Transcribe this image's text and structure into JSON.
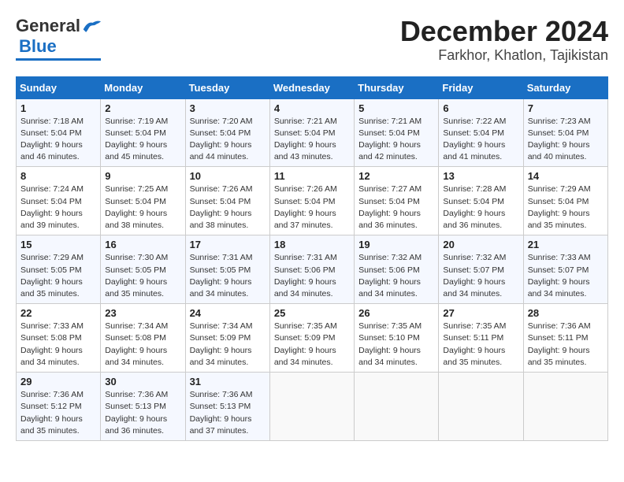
{
  "header": {
    "logo_general": "General",
    "logo_blue": "Blue",
    "month_title": "December 2024",
    "location": "Farkhor, Khatlon, Tajikistan"
  },
  "weekdays": [
    "Sunday",
    "Monday",
    "Tuesday",
    "Wednesday",
    "Thursday",
    "Friday",
    "Saturday"
  ],
  "weeks": [
    [
      {
        "day": "1",
        "sunrise": "7:18 AM",
        "sunset": "5:04 PM",
        "daylight": "9 hours and 46 minutes."
      },
      {
        "day": "2",
        "sunrise": "7:19 AM",
        "sunset": "5:04 PM",
        "daylight": "9 hours and 45 minutes."
      },
      {
        "day": "3",
        "sunrise": "7:20 AM",
        "sunset": "5:04 PM",
        "daylight": "9 hours and 44 minutes."
      },
      {
        "day": "4",
        "sunrise": "7:21 AM",
        "sunset": "5:04 PM",
        "daylight": "9 hours and 43 minutes."
      },
      {
        "day": "5",
        "sunrise": "7:21 AM",
        "sunset": "5:04 PM",
        "daylight": "9 hours and 42 minutes."
      },
      {
        "day": "6",
        "sunrise": "7:22 AM",
        "sunset": "5:04 PM",
        "daylight": "9 hours and 41 minutes."
      },
      {
        "day": "7",
        "sunrise": "7:23 AM",
        "sunset": "5:04 PM",
        "daylight": "9 hours and 40 minutes."
      }
    ],
    [
      {
        "day": "8",
        "sunrise": "7:24 AM",
        "sunset": "5:04 PM",
        "daylight": "9 hours and 39 minutes."
      },
      {
        "day": "9",
        "sunrise": "7:25 AM",
        "sunset": "5:04 PM",
        "daylight": "9 hours and 38 minutes."
      },
      {
        "day": "10",
        "sunrise": "7:26 AM",
        "sunset": "5:04 PM",
        "daylight": "9 hours and 38 minutes."
      },
      {
        "day": "11",
        "sunrise": "7:26 AM",
        "sunset": "5:04 PM",
        "daylight": "9 hours and 37 minutes."
      },
      {
        "day": "12",
        "sunrise": "7:27 AM",
        "sunset": "5:04 PM",
        "daylight": "9 hours and 36 minutes."
      },
      {
        "day": "13",
        "sunrise": "7:28 AM",
        "sunset": "5:04 PM",
        "daylight": "9 hours and 36 minutes."
      },
      {
        "day": "14",
        "sunrise": "7:29 AM",
        "sunset": "5:04 PM",
        "daylight": "9 hours and 35 minutes."
      }
    ],
    [
      {
        "day": "15",
        "sunrise": "7:29 AM",
        "sunset": "5:05 PM",
        "daylight": "9 hours and 35 minutes."
      },
      {
        "day": "16",
        "sunrise": "7:30 AM",
        "sunset": "5:05 PM",
        "daylight": "9 hours and 35 minutes."
      },
      {
        "day": "17",
        "sunrise": "7:31 AM",
        "sunset": "5:05 PM",
        "daylight": "9 hours and 34 minutes."
      },
      {
        "day": "18",
        "sunrise": "7:31 AM",
        "sunset": "5:06 PM",
        "daylight": "9 hours and 34 minutes."
      },
      {
        "day": "19",
        "sunrise": "7:32 AM",
        "sunset": "5:06 PM",
        "daylight": "9 hours and 34 minutes."
      },
      {
        "day": "20",
        "sunrise": "7:32 AM",
        "sunset": "5:07 PM",
        "daylight": "9 hours and 34 minutes."
      },
      {
        "day": "21",
        "sunrise": "7:33 AM",
        "sunset": "5:07 PM",
        "daylight": "9 hours and 34 minutes."
      }
    ],
    [
      {
        "day": "22",
        "sunrise": "7:33 AM",
        "sunset": "5:08 PM",
        "daylight": "9 hours and 34 minutes."
      },
      {
        "day": "23",
        "sunrise": "7:34 AM",
        "sunset": "5:08 PM",
        "daylight": "9 hours and 34 minutes."
      },
      {
        "day": "24",
        "sunrise": "7:34 AM",
        "sunset": "5:09 PM",
        "daylight": "9 hours and 34 minutes."
      },
      {
        "day": "25",
        "sunrise": "7:35 AM",
        "sunset": "5:09 PM",
        "daylight": "9 hours and 34 minutes."
      },
      {
        "day": "26",
        "sunrise": "7:35 AM",
        "sunset": "5:10 PM",
        "daylight": "9 hours and 34 minutes."
      },
      {
        "day": "27",
        "sunrise": "7:35 AM",
        "sunset": "5:11 PM",
        "daylight": "9 hours and 35 minutes."
      },
      {
        "day": "28",
        "sunrise": "7:36 AM",
        "sunset": "5:11 PM",
        "daylight": "9 hours and 35 minutes."
      }
    ],
    [
      {
        "day": "29",
        "sunrise": "7:36 AM",
        "sunset": "5:12 PM",
        "daylight": "9 hours and 35 minutes."
      },
      {
        "day": "30",
        "sunrise": "7:36 AM",
        "sunset": "5:13 PM",
        "daylight": "9 hours and 36 minutes."
      },
      {
        "day": "31",
        "sunrise": "7:36 AM",
        "sunset": "5:13 PM",
        "daylight": "9 hours and 37 minutes."
      },
      null,
      null,
      null,
      null
    ]
  ]
}
